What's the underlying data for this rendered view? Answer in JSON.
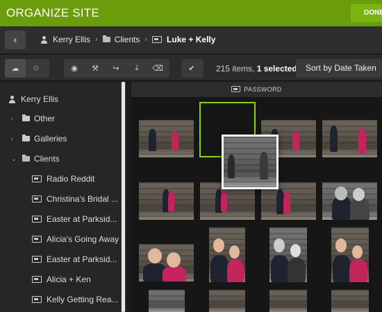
{
  "header": {
    "title": "ORGANIZE SITE",
    "done_label": "DONE",
    "accent_color": "#6a9c0c"
  },
  "nav": {
    "back_icon": "chevron-left-icon",
    "breadcrumbs": [
      {
        "label": "Kerry Ellis",
        "icon": "person-icon"
      },
      {
        "label": "Clients",
        "icon": "folder-open-icon"
      },
      {
        "label": "Luke + Kelly",
        "icon": "gallery-icon"
      }
    ]
  },
  "toolbar": {
    "buttons": [
      {
        "name": "upload-icon",
        "glyph": "☁"
      },
      {
        "name": "settings-icon",
        "glyph": "⚙"
      },
      {
        "name": "view-icon",
        "glyph": "◉"
      },
      {
        "name": "edit-icon",
        "glyph": "⚒"
      },
      {
        "name": "share-icon",
        "glyph": "↪"
      },
      {
        "name": "download-icon",
        "glyph": "⤓"
      },
      {
        "name": "delete-icon",
        "glyph": "⌫"
      },
      {
        "name": "check-icon",
        "glyph": "✔"
      }
    ],
    "count_text": "215 items,",
    "selected_text": "1 selected",
    "sort_label": "Sort by Date Taken"
  },
  "sidebar": {
    "root": "Kerry Ellis",
    "items": [
      {
        "label": "Other",
        "type": "folder"
      },
      {
        "label": "Galleries",
        "type": "folder"
      },
      {
        "label": "Clients",
        "type": "folder-open"
      }
    ],
    "children": [
      "Radio Reddit",
      "Christina's Bridal ...",
      "Easter at Parksid...",
      "Alicia's Going Away",
      "Easter at Parksid...",
      "Alicia + Ken",
      "Kelly Getting Rea..."
    ]
  },
  "content": {
    "password_label": "PASSWORD",
    "selection_color": "#8fd11a"
  }
}
